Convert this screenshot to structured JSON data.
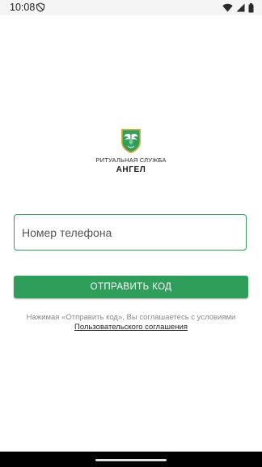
{
  "status_bar": {
    "time": "10:08",
    "icons": [
      "shield-icon",
      "wifi-icon",
      "signal-icon",
      "battery-icon"
    ]
  },
  "brand": {
    "caption": "РИТУАЛЬНАЯ СЛУЖБА",
    "name": "АНГЕЛ",
    "emblem": "angel-wings-emblem",
    "emblem_colors": {
      "shield": "#2e9e5a",
      "border": "#d4b23a",
      "wings": "#ffffff"
    }
  },
  "login": {
    "phone_placeholder": "Номер телефона",
    "phone_value": "",
    "send_button_label": "ОТПРАВИТЬ КОД",
    "terms_text": "Нажимая «Отправить код», Вы соглашаетесь с условиями",
    "terms_link": "Пользовательского соглашения"
  },
  "colors": {
    "accent": "#2e9e5a",
    "text_muted": "#8a8a8a",
    "status_bar_bg": "#f5f5f5",
    "nav_bar_bg": "#000000"
  }
}
